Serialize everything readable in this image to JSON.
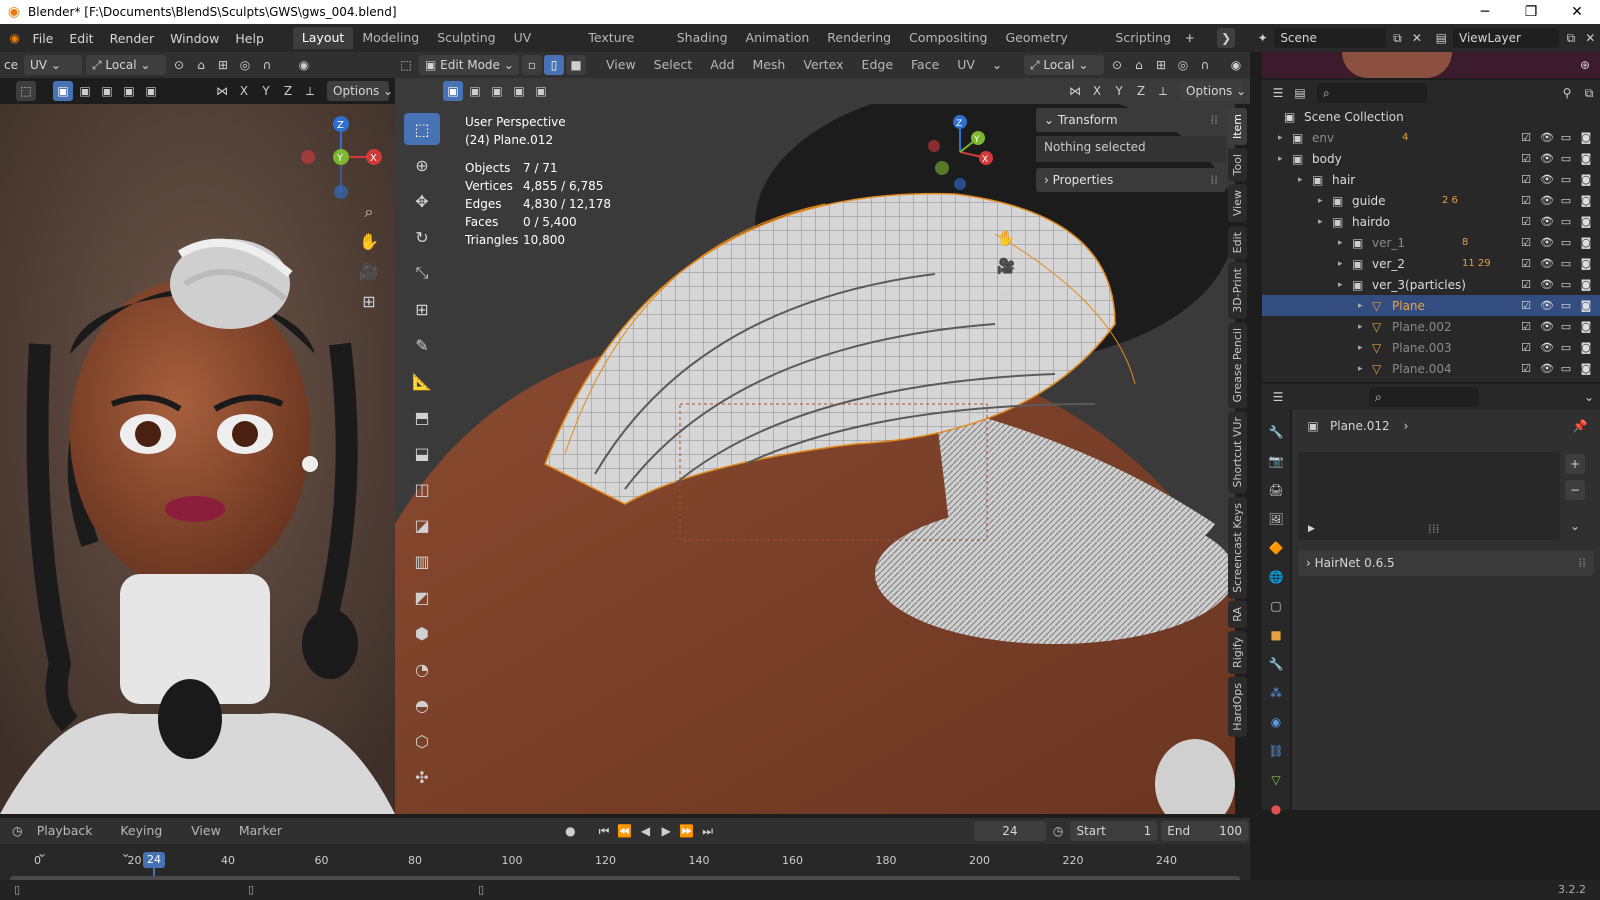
{
  "title_bar": {
    "title": "Blender* [F:\\Documents\\BlendS\\Sculpts\\GWS\\gws_004.blend]"
  },
  "menu": [
    "File",
    "Edit",
    "Render",
    "Window",
    "Help"
  ],
  "workspaces": [
    "Layout",
    "Modeling",
    "Sculpting",
    "UV Editing",
    "Texture Paint",
    "Shading",
    "Animation",
    "Rendering",
    "Compositing",
    "Geometry Nodes",
    "Scripting"
  ],
  "active_workspace": "Layout",
  "scene": {
    "label": "Scene",
    "view_layer": "ViewLayer"
  },
  "left_viewport": {
    "editor_label": "ce",
    "uv_dd": "UV",
    "transform_space": "Local",
    "options": "Options",
    "axes": [
      "X",
      "Y",
      "Z"
    ]
  },
  "main_viewport": {
    "mode": "Edit Mode",
    "menus": [
      "View",
      "Select",
      "Add",
      "Mesh",
      "Vertex",
      "Edge",
      "Face",
      "UV"
    ],
    "transform_space": "Local",
    "options": "Options",
    "axes": [
      "X",
      "Y",
      "Z"
    ],
    "perspective": "User Perspective",
    "object_name": "(24) Plane.012",
    "stats": [
      {
        "label": "Objects",
        "value": "7 / 71"
      },
      {
        "label": "Vertices",
        "value": "4,855 / 6,785"
      },
      {
        "label": "Edges",
        "value": "4,830 / 12,178"
      },
      {
        "label": "Faces",
        "value": "0 / 5,400"
      },
      {
        "label": "Triangles",
        "value": "10,800"
      }
    ]
  },
  "n_panel": {
    "transform": "Transform",
    "nothing_selected": "Nothing selected",
    "properties": "Properties",
    "tabs": [
      "Item",
      "Tool",
      "View",
      "Edit",
      "3D-Print",
      "Grease Pencil",
      "Shortcut VUr",
      "Screencast Keys",
      "RA",
      "Rigify",
      "HardOps"
    ]
  },
  "outliner": {
    "root": "Scene Collection",
    "rows": [
      {
        "name": "env",
        "indent": 1,
        "dim": true,
        "badge": "4"
      },
      {
        "name": "body",
        "indent": 1,
        "dim": false,
        "badge": ""
      },
      {
        "name": "hair",
        "indent": 2,
        "dim": false,
        "badge": ""
      },
      {
        "name": "guide",
        "indent": 3,
        "dim": false,
        "badge": "2 6"
      },
      {
        "name": "hairdo",
        "indent": 3,
        "dim": false,
        "badge": ""
      },
      {
        "name": "ver_1",
        "indent": 4,
        "dim": true,
        "badge": "8"
      },
      {
        "name": "ver_2",
        "indent": 4,
        "dim": false,
        "badge": "11 29"
      },
      {
        "name": "ver_3(particles)",
        "indent": 4,
        "dim": false,
        "badge": ""
      },
      {
        "name": "Plane",
        "indent": 5,
        "dim": false,
        "badge": "",
        "selected": true
      },
      {
        "name": "Plane.002",
        "indent": 5,
        "dim": true,
        "badge": ""
      },
      {
        "name": "Plane.003",
        "indent": 5,
        "dim": true,
        "badge": ""
      },
      {
        "name": "Plane.004",
        "indent": 5,
        "dim": true,
        "badge": ""
      }
    ]
  },
  "properties": {
    "object": "Plane.012",
    "addon": "HairNet 0.6.5"
  },
  "timeline": {
    "menus": [
      "Playback",
      "Keying",
      "View",
      "Marker"
    ],
    "current_frame": "24",
    "start_label": "Start",
    "start": "1",
    "end_label": "End",
    "end": "100",
    "ticks": [
      "0",
      "20",
      "40",
      "60",
      "80",
      "100",
      "120",
      "140",
      "160",
      "180",
      "200",
      "220",
      "240"
    ]
  },
  "status": {
    "version": "3.2.2"
  }
}
